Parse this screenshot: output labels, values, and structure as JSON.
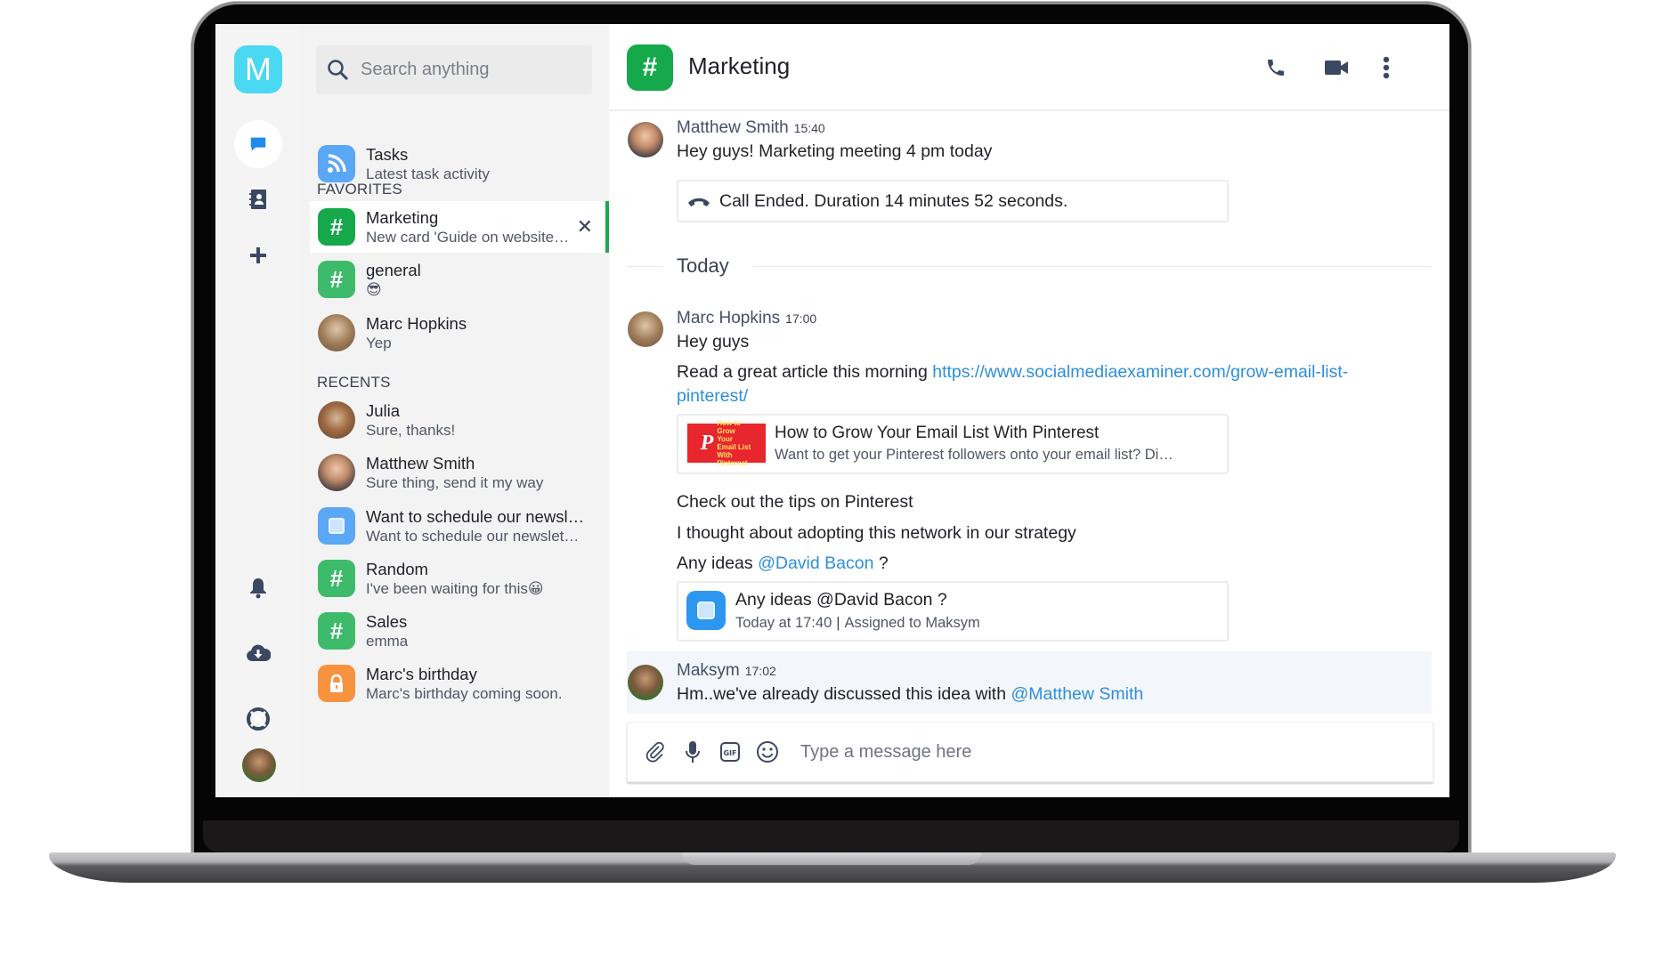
{
  "app": {
    "logo_letter": "M"
  },
  "colors": {
    "accent_green": "#16a94c",
    "link_blue": "#2d8fd9",
    "logo_cyan": "#4ad9f2",
    "tasks_blue": "#5aa7f5",
    "lock_orange": "#f7923f"
  },
  "rail": {
    "items": [
      {
        "name": "chat-icon",
        "active": true
      },
      {
        "name": "contacts-icon"
      },
      {
        "name": "add-icon"
      },
      {
        "name": "bell-icon"
      },
      {
        "name": "cloud-download-icon"
      },
      {
        "name": "lifebuoy-icon"
      },
      {
        "name": "user-avatar"
      }
    ]
  },
  "search": {
    "placeholder": "Search anything"
  },
  "tasks": {
    "title": "Tasks",
    "subtitle": "Latest task activity"
  },
  "favorites": {
    "label": "FAVORITES",
    "items": [
      {
        "title": "Marketing",
        "subtitle": "New card 'Guide on website o…",
        "icon": "hash",
        "active": true
      },
      {
        "title": "general",
        "subtitle": "😎",
        "icon": "hash"
      },
      {
        "title": "Marc Hopkins",
        "subtitle": "Yep",
        "icon": "avatar"
      }
    ]
  },
  "recents": {
    "label": "RECENTS",
    "items": [
      {
        "title": "Julia",
        "subtitle": "Sure, thanks!",
        "icon": "avatar"
      },
      {
        "title": "Matthew Smith",
        "subtitle": "Sure thing, send it my way",
        "icon": "avatar"
      },
      {
        "title": "Want to schedule our newsl…",
        "subtitle": "Want to schedule our newslet…",
        "icon": "task"
      },
      {
        "title": "Random",
        "subtitle": "I've been waiting for this😀",
        "icon": "hash"
      },
      {
        "title": "Sales",
        "subtitle": "emma",
        "icon": "hash"
      },
      {
        "title": "Marc's birthday",
        "subtitle": "Marc's birthday coming soon.",
        "icon": "lock"
      }
    ]
  },
  "chat": {
    "title": "Marketing",
    "messages": [
      {
        "author": "Matthew Smith",
        "time": "15:40",
        "text": "Hey guys! Marketing meeting 4 pm today",
        "call": "Call Ended. Duration 14 minutes 52 seconds."
      },
      {
        "author": "Marc Hopkins",
        "time": "17:00",
        "lines": [
          "Hey guys",
          "Read a great article this morning",
          "Check out the tips on Pinterest",
          "I thought about adopting this network in our strategy",
          "Any ideas"
        ],
        "url_part1": "https://www.socialmediaexaminer.com/grow-email-list-",
        "url_part2": "pinterest/",
        "mention": "@David Bacon",
        "mention_suffix": " ?",
        "preview": {
          "title": "How to Grow Your Email List With Pinterest",
          "desc": "Want to get your Pinterest followers onto your email list? Di…"
        },
        "task": {
          "title": "Any ideas @David Bacon ?",
          "when": "Today at 17:40",
          "assigned": "Assigned to Maksym"
        }
      },
      {
        "author": "Maksym",
        "time": "17:02",
        "text": "Hm..we've already discussed this idea with",
        "mention": "@Matthew Smith"
      }
    ],
    "divider": "Today",
    "composer_placeholder": "Type a message here"
  }
}
